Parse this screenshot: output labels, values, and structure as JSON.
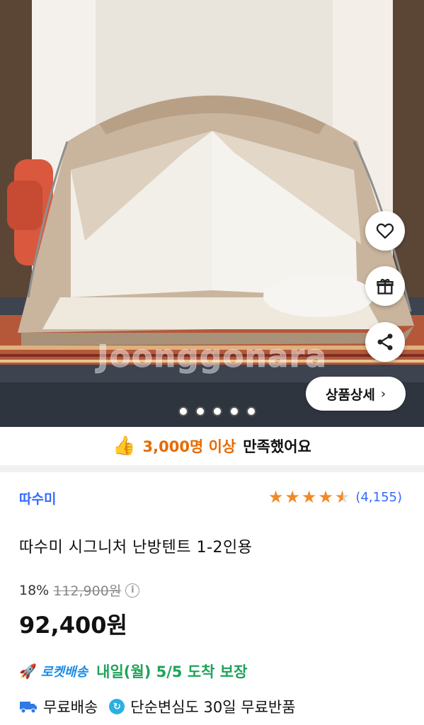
{
  "hero": {
    "watermark": "Joonggonara",
    "actions": {
      "heart_icon": "heart-outline-icon",
      "gift_icon": "gift-icon",
      "share_icon": "share-icon"
    },
    "detail_button_label": "상품상세",
    "detail_button_chevron": "›",
    "carousel": {
      "dot_count": 5
    }
  },
  "satisfaction": {
    "icon": "thumbs-up-icon",
    "count_text": "3,000명 이상",
    "rest_text": "만족했어요"
  },
  "product": {
    "brand": "따수미",
    "rating": {
      "stars": 4.5,
      "review_count": "(4,155)"
    },
    "title": "따수미 시그니처 난방텐트 1-2인용",
    "discount": "18%",
    "original_price": "112,900원",
    "info_icon_glyph": "i",
    "sale_price": "92,400원"
  },
  "delivery": {
    "rocket_icon": "rocket-icon",
    "rocket_label": "로켓배송",
    "arrival_text": "내일(월) 5/5 도착 보장",
    "truck_icon": "truck-icon",
    "free_shipping": "무료배송",
    "return_icon": "return-icon",
    "return_policy": "단순변심도 30일 무료반품"
  },
  "colors": {
    "brand_blue": "#346aff",
    "star_orange": "#f08a24",
    "satisfaction_orange": "#e66b00",
    "delivery_green": "#1fa35a",
    "rocket_blue": "#1b8be6"
  }
}
